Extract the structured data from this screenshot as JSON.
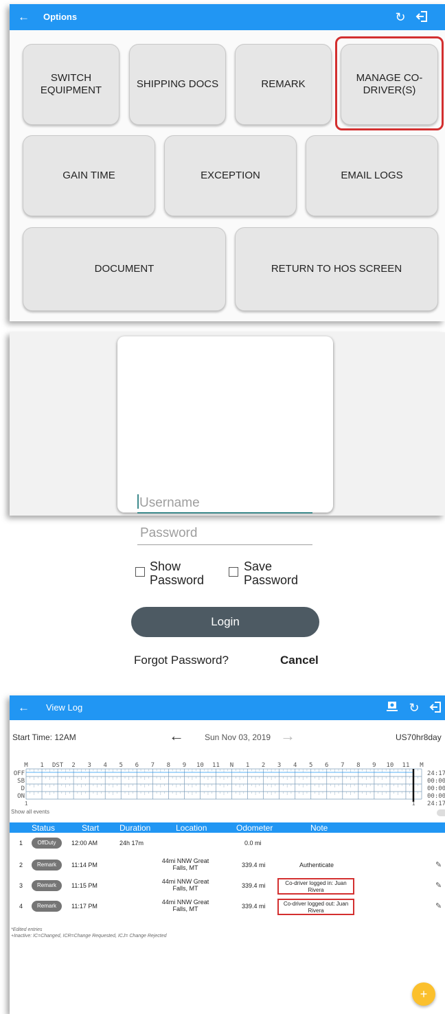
{
  "options_screen": {
    "title": "Options",
    "back_icon": "arrow-left-icon",
    "refresh_icon": "refresh-icon",
    "logout_icon": "logout-icon",
    "buttons": {
      "switch_equipment": "SWITCH EQUIPMENT",
      "shipping_docs": "SHIPPING DOCS",
      "remark": "REMARK",
      "manage_codrivers": "MANAGE CO-DRIVER(S)",
      "gain_time": "GAIN TIME",
      "exception": "EXCEPTION",
      "email_logs": "EMAIL LOGS",
      "document": "DOCUMENT",
      "return_hos": "RETURN TO HOS SCREEN"
    },
    "highlight_color": "#d32f2f"
  },
  "login_dialog": {
    "username_placeholder": "Username",
    "password_placeholder": "Password",
    "show_password": "Show Password",
    "save_password": "Save Password",
    "login_label": "Login",
    "forgot_label": "Forgot Password?",
    "cancel_label": "Cancel"
  },
  "view_log": {
    "title": "View Log",
    "start_time": "Start Time: 12AM",
    "date": "Sun Nov 03, 2019",
    "ruleset": "US70hr8day",
    "status_labels": [
      "OFF",
      "SB",
      "D",
      "ON"
    ],
    "hour_labels": [
      "M",
      "1",
      "DST",
      "2",
      "3",
      "4",
      "5",
      "6",
      "7",
      "8",
      "9",
      "10",
      "11",
      "N",
      "1",
      "2",
      "3",
      "4",
      "5",
      "6",
      "7",
      "8",
      "9",
      "10",
      "11",
      "M"
    ],
    "totals": [
      "24:17",
      "00:00",
      "00:00",
      "00:00",
      "24:17"
    ],
    "grid_footer_left": "1",
    "grid_footer_right": "1",
    "show_all_events": "Show all events",
    "columns": [
      "Status",
      "Start",
      "Duration",
      "Location",
      "Odometer",
      "Note"
    ],
    "rows": [
      {
        "num": "1",
        "status": "OffDuty",
        "start": "12:00 AM",
        "duration": "24h 17m",
        "location": "",
        "odometer": "0.0 mi",
        "note": ""
      },
      {
        "num": "2",
        "status": "Remark",
        "start": "11:14 PM",
        "duration": "",
        "location": "44mi NNW Great Falls, MT",
        "odometer": "339.4 mi",
        "note": "Authenticate"
      },
      {
        "num": "3",
        "status": "Remark",
        "start": "11:15 PM",
        "duration": "",
        "location": "44mi NNW Great Falls, MT",
        "odometer": "339.4 mi",
        "note": "Co-driver logged in: Juan Rivera"
      },
      {
        "num": "4",
        "status": "Remark",
        "start": "11:17 PM",
        "duration": "",
        "location": "44mi NNW Great Falls, MT",
        "odometer": "339.4 mi",
        "note": "Co-driver logged out: Juan Rivera"
      }
    ],
    "footnote_1": "*Edited entries",
    "footnote_2": "+Inactive: IC=Changed, ICR=Change Requested, ICJ= Change Rejected",
    "fab_label": "+"
  }
}
